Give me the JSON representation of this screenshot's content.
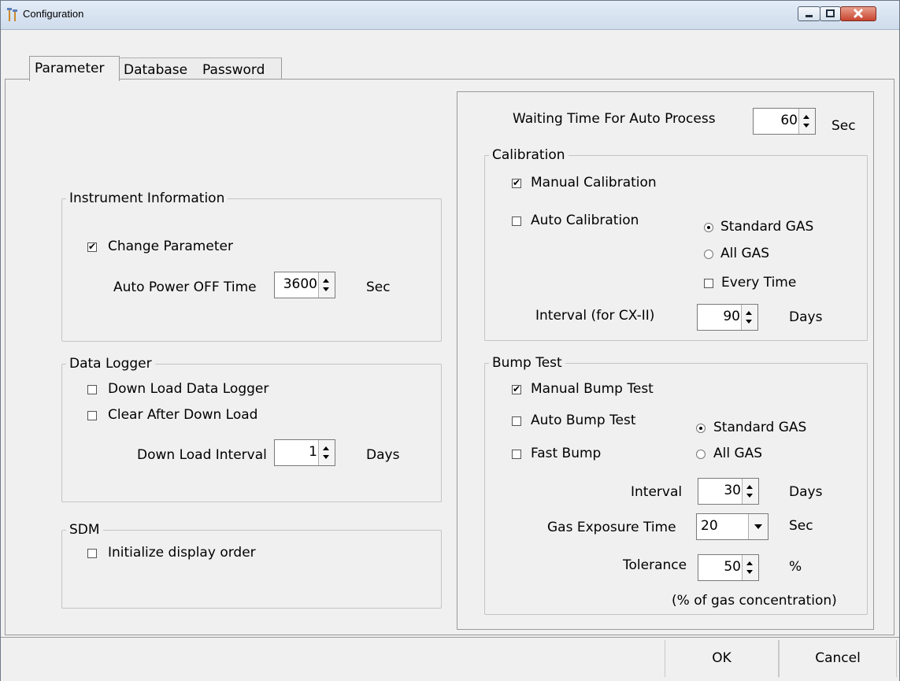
{
  "window": {
    "title": "Configuration"
  },
  "tabs": [
    "Parameter",
    "Database",
    "Password"
  ],
  "instrument_information": {
    "legend": "Instrument Information",
    "change_parameter": {
      "label": "Change Parameter",
      "checked": true
    },
    "auto_power_off": {
      "label": "Auto Power OFF Time",
      "value": "3600",
      "unit": "Sec"
    }
  },
  "data_logger": {
    "legend": "Data Logger",
    "download": {
      "label": "Down Load Data Logger",
      "checked": false
    },
    "clear_after": {
      "label": "Clear After Down Load",
      "checked": false
    },
    "interval": {
      "label": "Down Load Interval",
      "value": "1",
      "unit": "Days"
    }
  },
  "sdm": {
    "legend": "SDM",
    "initialize": {
      "label": "Initialize display order",
      "checked": false
    }
  },
  "auto_process": {
    "label": "Waiting Time For Auto Process",
    "value": "60",
    "unit": "Sec"
  },
  "calibration": {
    "legend": "Calibration",
    "manual": {
      "label": "Manual Calibration",
      "checked": true
    },
    "auto": {
      "label": "Auto Calibration",
      "checked": false
    },
    "standard_gas": {
      "label": "Standard GAS",
      "selected": true
    },
    "all_gas": {
      "label": "All GAS",
      "selected": false
    },
    "every_time": {
      "label": "Every Time",
      "checked": false
    },
    "interval": {
      "label": "Interval (for CX-II)",
      "value": "90",
      "unit": "Days"
    }
  },
  "bump_test": {
    "legend": "Bump Test",
    "manual": {
      "label": "Manual Bump Test",
      "checked": true
    },
    "auto": {
      "label": "Auto Bump Test",
      "checked": false
    },
    "fast": {
      "label": "Fast Bump",
      "checked": false
    },
    "standard_gas": {
      "label": "Standard GAS",
      "selected": true
    },
    "all_gas": {
      "label": "All GAS",
      "selected": false
    },
    "interval": {
      "label": "Interval",
      "value": "30",
      "unit": "Days"
    },
    "exposure": {
      "label": "Gas Exposure Time",
      "value": "20",
      "unit": "Sec"
    },
    "tolerance": {
      "label": "Tolerance",
      "value": "50",
      "unit": "%"
    },
    "note": "(% of gas concentration)"
  },
  "buttons": {
    "ok": "OK",
    "cancel": "Cancel"
  }
}
